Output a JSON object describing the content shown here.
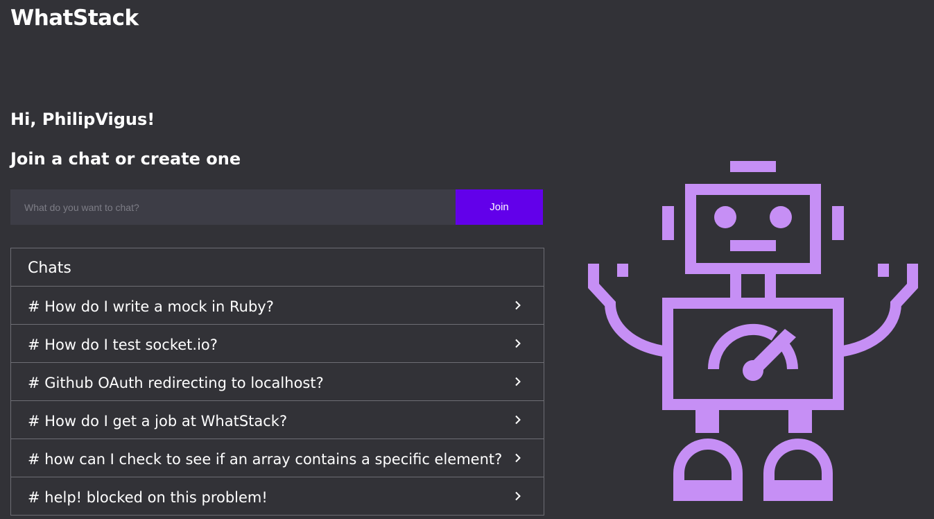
{
  "app": {
    "title": "WhatStack"
  },
  "greeting": "Hi, PhilipVigus!",
  "subheading": "Join a chat or create one",
  "join_form": {
    "placeholder": "What do you want to chat?",
    "value": "",
    "button_label": "Join"
  },
  "chats": {
    "header": "Chats",
    "items": [
      {
        "label": "# How do I write a mock in Ruby?"
      },
      {
        "label": "# How do I test socket.io?"
      },
      {
        "label": "# Github OAuth redirecting to localhost?"
      },
      {
        "label": "# How do I get a job at WhatStack?"
      },
      {
        "label": "# how can I check to see if an array contains a specific element?"
      },
      {
        "label": "# help! blocked on this problem!"
      }
    ]
  },
  "colors": {
    "background": "#323237",
    "input_background": "#3d3d46",
    "accent": "#6200ea",
    "robot": "#c68ff5",
    "border": "#6e6e74"
  },
  "icons": {
    "row_chevron": "chevron-right-icon",
    "illustration": "robot-illustration"
  }
}
